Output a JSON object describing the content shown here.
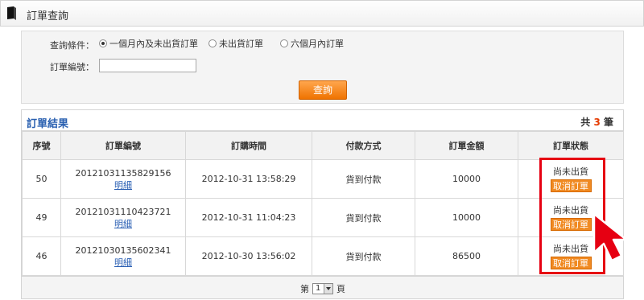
{
  "header": {
    "title": "訂單查詢"
  },
  "search": {
    "condition_label": "查詢條件：",
    "options": [
      {
        "label": "一個月內及未出貨訂單",
        "selected": true
      },
      {
        "label": "未出貨訂單",
        "selected": false
      },
      {
        "label": "六個月內訂單",
        "selected": false
      }
    ],
    "order_no_label": "訂單編號：",
    "order_no_value": "",
    "submit_label": "查詢"
  },
  "results": {
    "title": "訂單結果",
    "count_prefix": "共",
    "count": "3",
    "count_suffix": "筆",
    "columns": [
      "序號",
      "訂單編號",
      "訂購時間",
      "付款方式",
      "訂單金額",
      "訂單狀態"
    ],
    "rows": [
      {
        "seq": "50",
        "order_no": "20121031135829156",
        "detail": "明細",
        "time": "2012-10-31 13:58:29",
        "payment": "貨到付款",
        "amount": "10000",
        "status": "尚未出貨",
        "action": "取消訂單"
      },
      {
        "seq": "49",
        "order_no": "20121031110423721",
        "detail": "明細",
        "time": "2012-10-31 11:04:23",
        "payment": "貨到付款",
        "amount": "10000",
        "status": "尚未出貨",
        "action": "取消訂單"
      },
      {
        "seq": "46",
        "order_no": "20121030135602341",
        "detail": "明細",
        "time": "2012-10-30 13:56:02",
        "payment": "貨到付款",
        "amount": "86500",
        "status": "尚未出貨",
        "action": "取消訂單"
      }
    ]
  },
  "pager": {
    "prefix": "第",
    "page": "1",
    "suffix": "頁"
  },
  "colors": {
    "accent": "#ef7300",
    "link": "#2a5fb3",
    "highlight": "#e60012"
  },
  "icons": {
    "header": "book-icon",
    "annotation": "red-arrow-cursor-icon"
  }
}
